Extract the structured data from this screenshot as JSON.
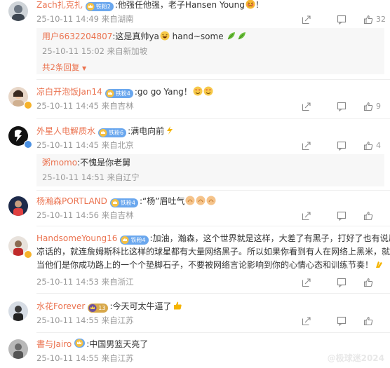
{
  "colors": {
    "username": "#eb7350",
    "meta": "#999999",
    "reply_bg": "#f7f7f7",
    "fan_badge": "#6aa7ee"
  },
  "comments": [
    {
      "user": "Zach扎克扎",
      "fan": "铁粉2",
      "text": ":他强任他强，老子Hansen Young",
      "text_end": "！",
      "time": "25-10-11 14:49 来自湖南",
      "likes": "32",
      "replies": [
        {
          "user": "用户6632204807",
          "text": ":这是真帅ya",
          "text2": " hand~some",
          "time": "25-10-11 15:02 来自新加坡"
        }
      ],
      "more": "共2条回复"
    },
    {
      "user": "凉白开泡饭Jan14",
      "fan": "铁粉4",
      "text": ":go go Yang！",
      "time": "25-10-11 14:45 来自吉林",
      "likes": "9"
    },
    {
      "user": "外星人电解质水",
      "fan": "铁粉6",
      "text": ":满电向前",
      "time": "25-10-11 14:45 来自北京",
      "likes": "4",
      "replies": [
        {
          "user": "粥momo",
          "text": ":不愧是你老舅",
          "time": "25-10-11 14:51 来自辽宁"
        }
      ]
    },
    {
      "user": "杨瀚森PORTLAND",
      "fan": "铁粉4",
      "text": ":“杨”眉吐气",
      "time": "25-10-11 14:56 来自吉林",
      "likes": ""
    },
    {
      "user": "HandsomeYoung16",
      "fan": "铁粉4",
      "text_l1": ":加油，瀚森，这个世界就是这样，大差了有黑子，打好了也有说风",
      "text_l2": "凉话的，就连詹姆斯科比这样的球星都有大量网络黑子。所以如果你看到有人在网络上黑米，就",
      "text_l3": "当他们是你成功路上的一个个垫脚石子，不要被网络言论影响到你的心情心态和训练节奏！",
      "time": "25-10-11 14:53 来自浙江",
      "likes": ""
    },
    {
      "user": "水花Forever",
      "fan": "13",
      "text": ":今天可太牛逼了",
      "time": "25-10-11 14:55 来自江苏",
      "likes": ""
    },
    {
      "user": "書与Jairo",
      "fan": "",
      "text": ":中国男篮天亮了",
      "time": "25-10-11 14:55 来自江苏",
      "likes": ""
    }
  ],
  "watermark": "@极球迷2024"
}
